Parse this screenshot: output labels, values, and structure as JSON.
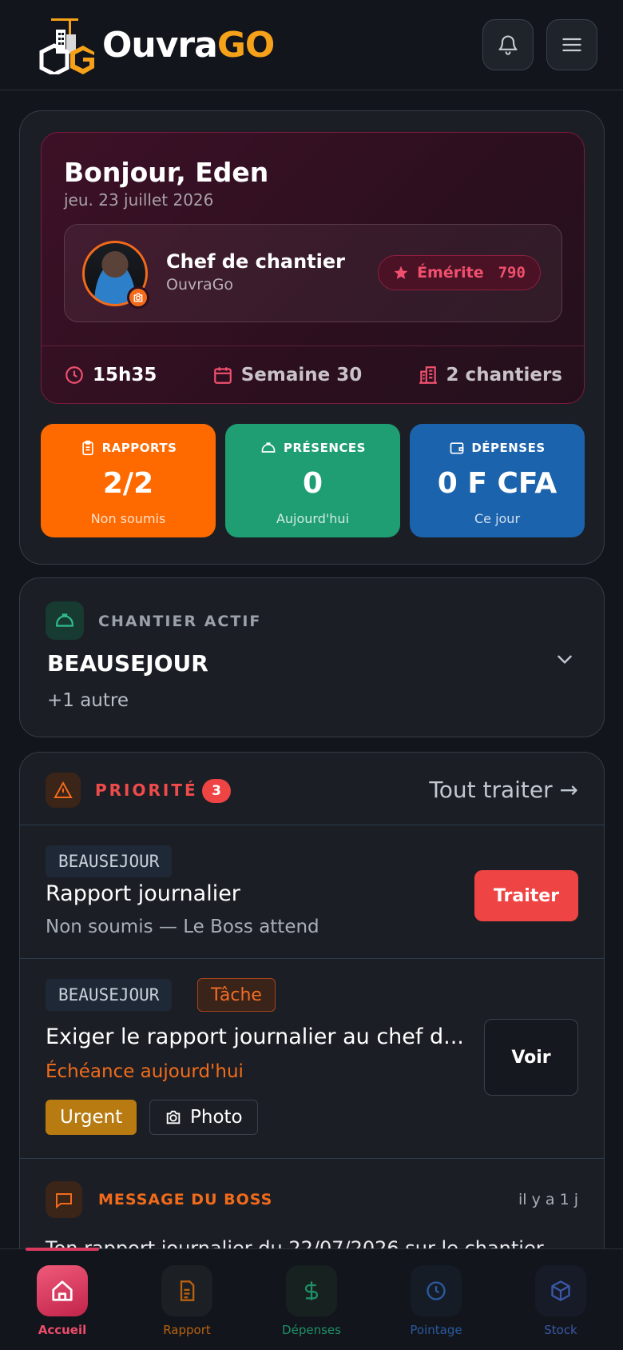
{
  "app": {
    "name_main": "Ouvra",
    "name_accent": "GO"
  },
  "greeting": {
    "title": "Bonjour, Eden",
    "date": "jeu. 23 juillet 2026",
    "role": "Chef de chantier",
    "company": "OuvraGo",
    "badge_label": "Émérite",
    "badge_points": "790",
    "time": "15h35",
    "week": "Semaine 30",
    "sites_count": "2 chantiers"
  },
  "tiles": [
    {
      "label": "RAPPORTS",
      "value": "2/2",
      "sub": "Non soumis"
    },
    {
      "label": "PRÉSENCES",
      "value": "0",
      "sub": "Aujourd'hui"
    },
    {
      "label": "DÉPENSES",
      "value": "0 F CFA",
      "sub": "Ce jour"
    }
  ],
  "active_site": {
    "label": "CHANTIER ACTIF",
    "name": "BEAUSEJOUR",
    "more": "+1 autre"
  },
  "priority": {
    "title": "PRIORITÉ",
    "count": "3",
    "all_label": "Tout traiter →",
    "items": [
      {
        "site": "BEAUSEJOUR",
        "title": "Rapport journalier",
        "sub": "Non soumis — Le Boss attend",
        "action": "Traiter"
      },
      {
        "site": "BEAUSEJOUR",
        "tag": "Tâche",
        "title": "Exiger le rapport journalier au chef d...",
        "due": "Échéance aujourd'hui",
        "chip_urgent": "Urgent",
        "chip_photo": "Photo",
        "action": "Voir"
      }
    ],
    "message": {
      "title": "MESSAGE DU BOSS",
      "time": "il y a 1 j",
      "body": "Ton rapport journalier du 22/07/2026 sur le chantier"
    }
  },
  "nav": [
    {
      "label": "Accueil",
      "icon": "home-icon",
      "color": "#ffffff"
    },
    {
      "label": "Rapport",
      "icon": "document-icon",
      "color": "#b8620f"
    },
    {
      "label": "Dépenses",
      "icon": "dollar-icon",
      "color": "#1f8f66"
    },
    {
      "label": "Pointage",
      "icon": "clock-icon",
      "color": "#2a5aa0"
    },
    {
      "label": "Stock",
      "icon": "box-icon",
      "color": "#3b58a8"
    }
  ],
  "colors": {
    "orange": "#fe6a00",
    "green": "#1f9e73",
    "blue": "#1c63ad",
    "danger": "#ef4444",
    "brand_accent": "#f6a11a"
  }
}
